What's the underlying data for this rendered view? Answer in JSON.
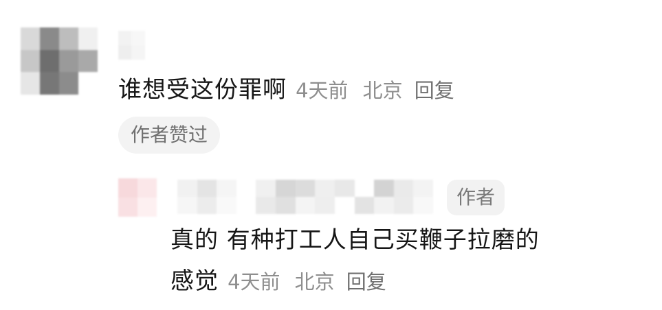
{
  "main_comment": {
    "content": "谁想受这份罪啊",
    "time": "4天前",
    "location": "北京",
    "reply_label": "回复",
    "liked_by_author_badge": "作者赞过"
  },
  "reply_comment": {
    "author_badge": "作者",
    "content_line1": "真的 有种打工人自己买鞭子拉磨的",
    "content_line2": "感觉",
    "time": "4天前",
    "location": "北京",
    "reply_label": "回复"
  },
  "colors": {
    "text_primary": "#161616",
    "text_meta": "#8e8e8e",
    "badge_bg": "#f2f2f2",
    "background": "#ffffff"
  }
}
